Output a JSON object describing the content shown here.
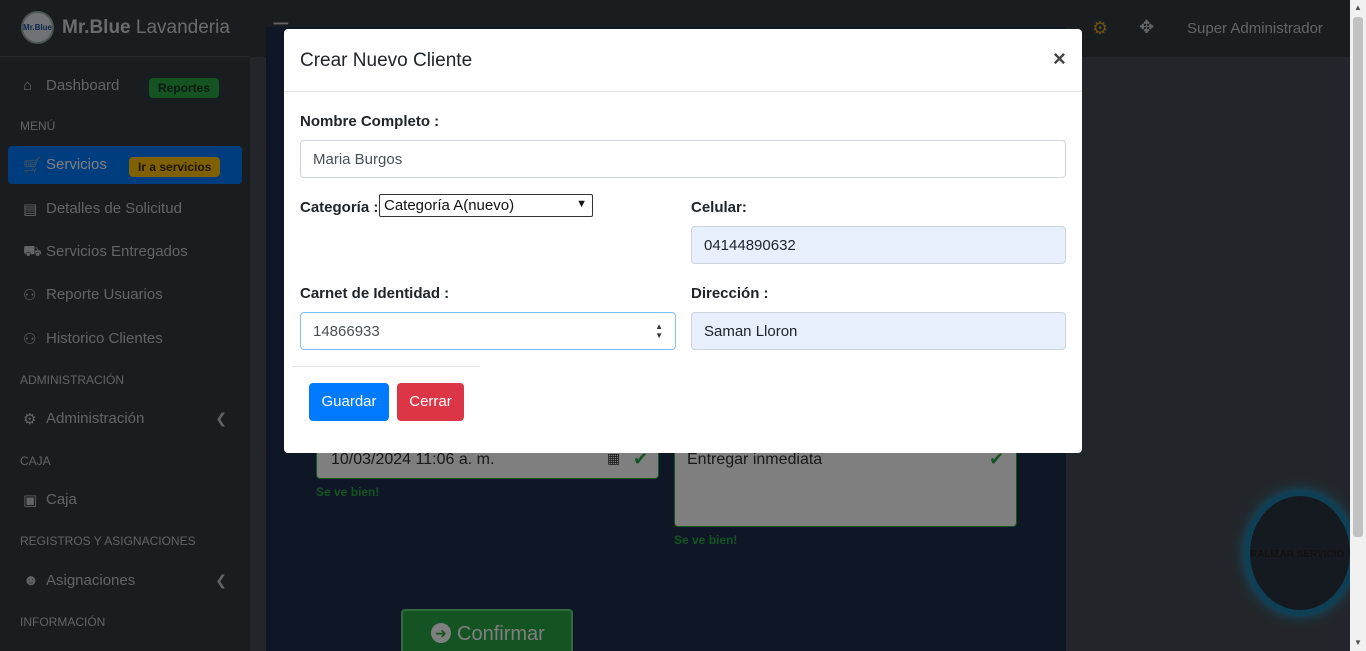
{
  "app": {
    "brand_logo": "Mr.Blue",
    "brand_name_bold": "Mr.Blue",
    "brand_name_rest": " Lavanderia",
    "user_name": "Super Administrador"
  },
  "sidebar": {
    "items": [
      {
        "label": "Dashboard",
        "icon": "home-icon",
        "badge": "Reportes"
      },
      {
        "header": "MENÚ"
      },
      {
        "label": "Servicios",
        "icon": "cart-icon",
        "badge": "Ir a servicios"
      },
      {
        "label": "Detalles de Solicitud",
        "icon": "list-icon"
      },
      {
        "label": "Servicios Entregados",
        "icon": "truck-icon"
      },
      {
        "label": "Reporte Usuarios",
        "icon": "users-icon"
      },
      {
        "label": "Historico Clientes",
        "icon": "users-icon"
      },
      {
        "header": "ADMINISTRACIÓN"
      },
      {
        "label": "Administración",
        "icon": "gear-icon"
      },
      {
        "header": "CAJA"
      },
      {
        "label": "Caja",
        "icon": "briefcase-icon"
      },
      {
        "header": "REGISTROS Y ASIGNACIONES"
      },
      {
        "label": "Asignaciones",
        "icon": "user-icon"
      },
      {
        "header": "INFORMACIÓN"
      }
    ]
  },
  "background_form": {
    "date_value": "10/03/2024  11:06  a. m.",
    "notes_value": "Entregar inmediata",
    "valid_text": "Se ve bien!",
    "confirm_label": "Confirmar",
    "float_button_label": "RALIZAR SERVICIO"
  },
  "modal": {
    "title": "Crear Nuevo Cliente",
    "close_symbol": "×",
    "fields": {
      "nombre_label": "Nombre Completo :",
      "nombre_value": "Maria Burgos",
      "categoria_label": "Categoría :",
      "categoria_value": "Categoría A(nuevo)",
      "celular_label": "Celular:",
      "celular_value": "04144890632",
      "carnet_label": "Carnet de Identidad :",
      "carnet_value": "14866933",
      "direccion_label": "Dirección :",
      "direccion_value": "Saman Lloron"
    },
    "buttons": {
      "save_label": "Guardar",
      "close_label": "Cerrar"
    }
  },
  "colors": {
    "primary": "#007bff",
    "danger": "#dc3545",
    "success": "#28a745",
    "sidebar_bg": "#343a40"
  }
}
